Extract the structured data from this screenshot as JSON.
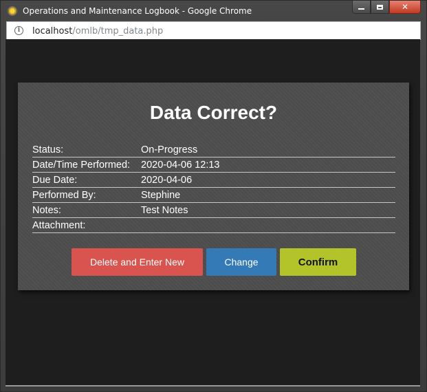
{
  "window": {
    "title": "Operations and Maintenance Logbook - Google Chrome",
    "controls": {
      "minimize": "minimize",
      "maximize": "maximize",
      "close": "close"
    }
  },
  "address": {
    "host": "localhost",
    "path": "/omlb/tmp_data.php"
  },
  "dialog": {
    "title": "Data Correct?",
    "rows": [
      {
        "label": "Status:",
        "value": "On-Progress"
      },
      {
        "label": "Date/Time Performed:",
        "value": "2020-04-06 12:13"
      },
      {
        "label": "Due Date:",
        "value": "2020-04-06"
      },
      {
        "label": "Performed By:",
        "value": "Stephine"
      },
      {
        "label": "Notes:",
        "value": "Test Notes"
      },
      {
        "label": "Attachment:",
        "value": ""
      }
    ],
    "buttons": {
      "delete": "Delete and Enter New",
      "change": "Change",
      "confirm": "Confirm"
    }
  },
  "colors": {
    "delete_button": "#d9534f",
    "change_button": "#337ab7",
    "confirm_button": "#b3c42a",
    "page_background": "#1e1e1e",
    "dialog_background": "#4d4d4d"
  }
}
